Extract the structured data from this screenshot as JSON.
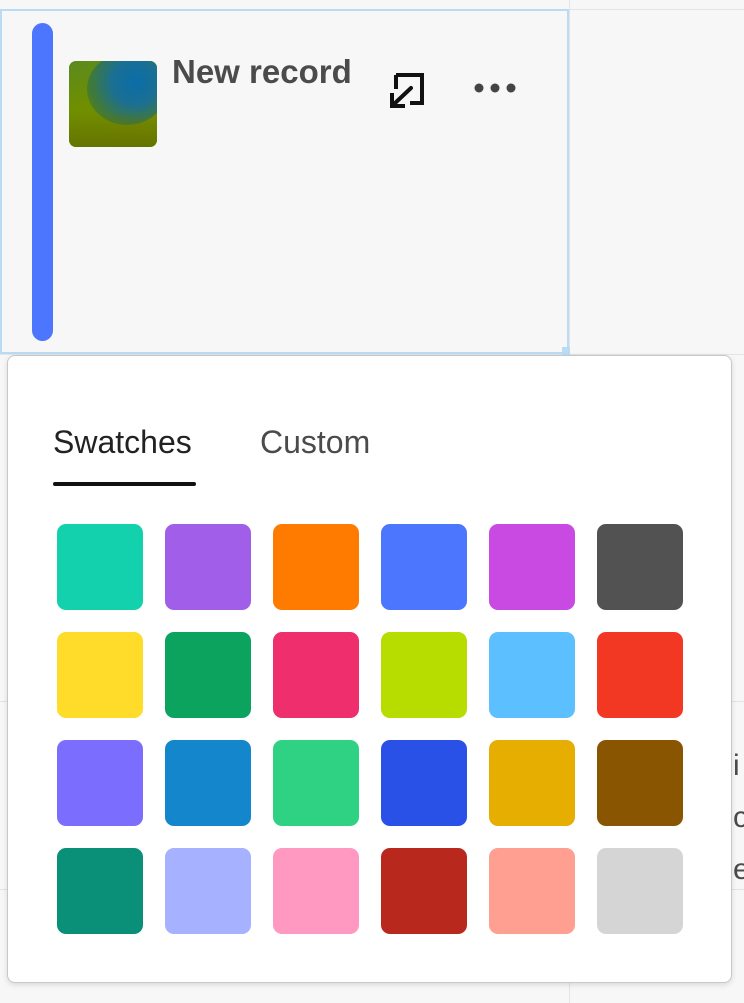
{
  "record": {
    "title": "New record",
    "accent_color": "#4d76ff",
    "icons": [
      "open-in-new-icon",
      "more-options-icon"
    ]
  },
  "side_text": [
    "i",
    "c",
    "e"
  ],
  "color_picker": {
    "tabs": [
      {
        "label": "Swatches",
        "selected": true
      },
      {
        "label": "Custom",
        "selected": false
      }
    ],
    "swatches": [
      "#12d1ac",
      "#a15ee8",
      "#ff7b00",
      "#4d76ff",
      "#c94ae2",
      "#525252",
      "#ffdc2a",
      "#0ba35d",
      "#ee2e6d",
      "#b7dc00",
      "#5cbfff",
      "#f23723",
      "#7b6eff",
      "#1486cc",
      "#2ed282",
      "#2951e8",
      "#e6ae00",
      "#8a5500",
      "#0a9078",
      "#a6b1ff",
      "#ff99c2",
      "#b8281d",
      "#ff9f91",
      "#d5d5d5"
    ]
  }
}
